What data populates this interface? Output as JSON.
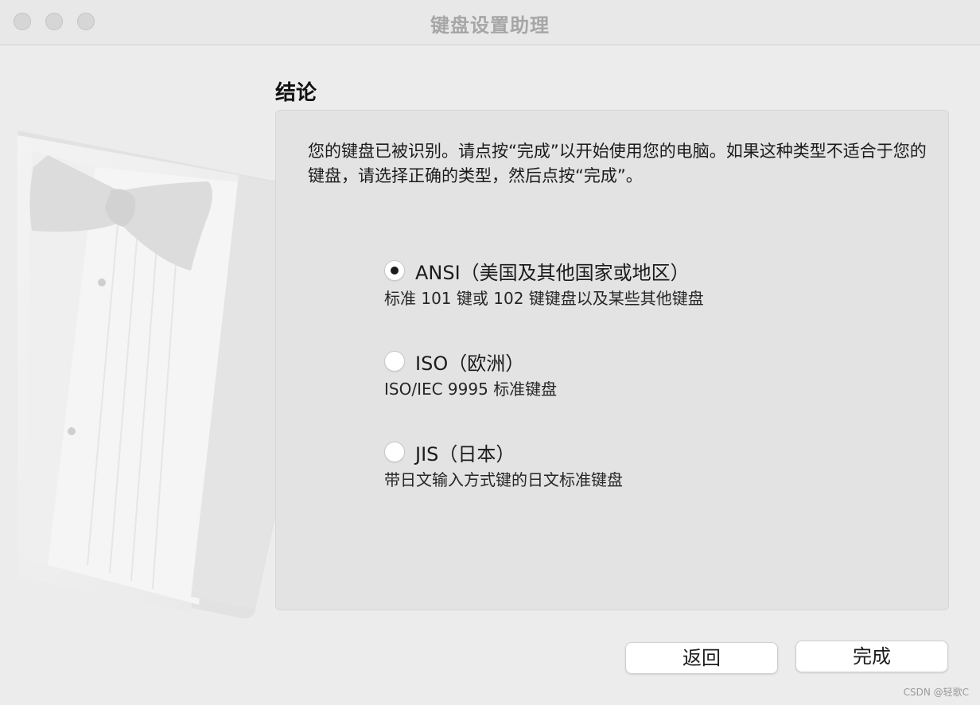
{
  "window": {
    "title": "键盘设置助理"
  },
  "section": {
    "title": "结论"
  },
  "intro": "您的键盘已被识别。请点按“完成”以开始使用您的电脑。如果这种类型不适合于您的键盘，请选择正确的类型，然后点按“完成”。",
  "options": [
    {
      "label": "ANSI（美国及其他国家或地区）",
      "description": "标准 101 键或 102 键键盘以及某些其他键盘",
      "selected": true
    },
    {
      "label": "ISO（欧洲）",
      "description": "ISO/IEC 9995 标准键盘",
      "selected": false
    },
    {
      "label": "JIS（日本）",
      "description": "带日文输入方式键的日文标准键盘",
      "selected": false
    }
  ],
  "buttons": {
    "back": "返回",
    "done": "完成"
  },
  "watermark": "CSDN @轻歌C"
}
